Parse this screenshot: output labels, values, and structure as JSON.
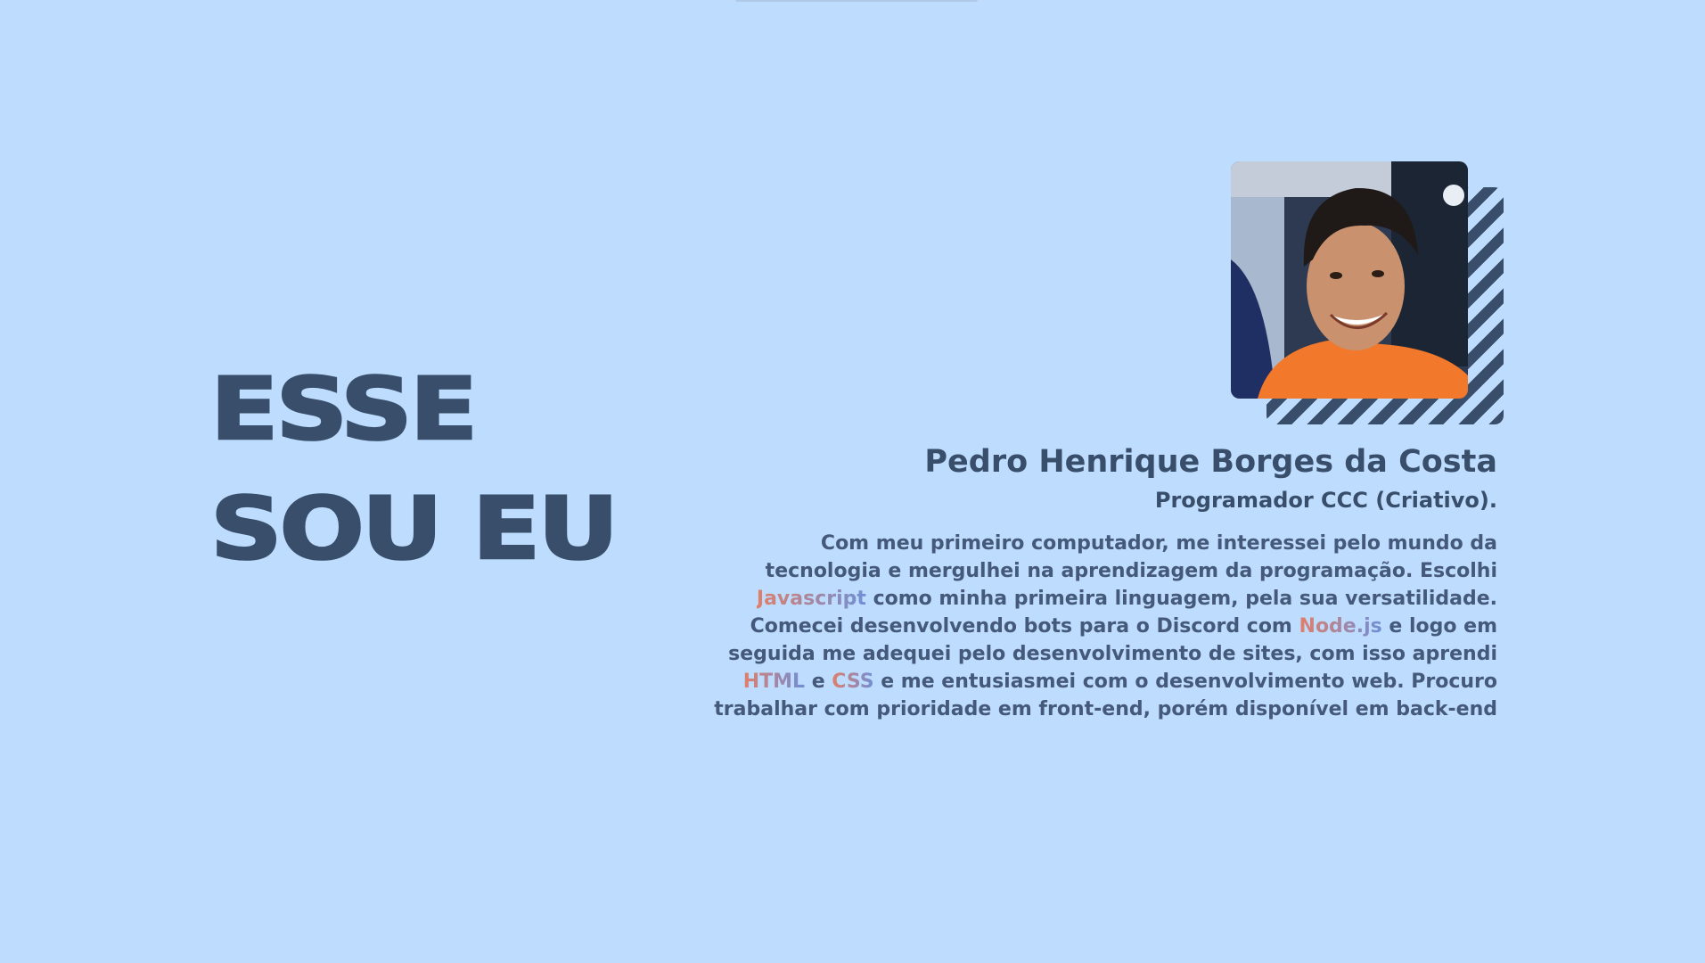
{
  "hero": {
    "line1": "ESSE",
    "line2": "SOU EU"
  },
  "profile": {
    "name": "Pedro Henrique Borges da Costa",
    "role": "Programador CCC (Criativo).",
    "photo_alt": "Foto de Pedro Henrique Borges da Costa",
    "bio": [
      "Com meu primeiro computador, me interessei pelo mundo da tecnologia e mergulhei na aprendizagem da programação. Escolhi ",
      "Javascript",
      " como minha primeira linguagem, pela sua versatilidade. Comecei desenvolvendo bots para o Discord com ",
      "Node.js",
      " e logo em seguida me adequei pelo desenvolvimento de sites, com isso aprendi ",
      "HTML",
      " e ",
      "CSS",
      " e me entusiasmei com o desenvolvimento web. Procuro trabalhar com prioridade em front-end, porém disponível em back-end"
    ]
  },
  "colors": {
    "background": "#bddcfe",
    "primary": "#384e6b",
    "highlight_start": "#e07f6a",
    "highlight_end": "#6f8fd6"
  }
}
